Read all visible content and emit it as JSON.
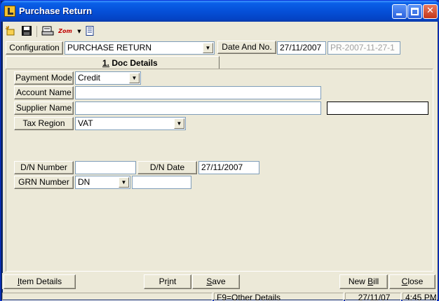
{
  "window": {
    "title": "Purchase Return"
  },
  "toolbar": {
    "icons": [
      "new-icon",
      "save-icon",
      "print-preview-icon",
      "zoom-icon",
      "dropdown-icon",
      "document-icon"
    ],
    "zoom_label": "Zom"
  },
  "header": {
    "configuration_label": "Configuration",
    "doc_type": "PURCHASE RETURN",
    "date_label": "Date And No.",
    "date": "27/11/2007",
    "doc_no": "PR-2007-11-27-1"
  },
  "tab": {
    "number": "1.",
    "label": "Doc Details"
  },
  "form": {
    "payment_mode_label": "Payment Mode",
    "payment_mode": "Credit",
    "account_name_label": "Account Name",
    "account_name": "",
    "supplier_name_label": "Supplier Name",
    "supplier_name": "",
    "tax_region_label": "Tax Region",
    "tax_region": "VAT",
    "dn_number_label": "D/N Number",
    "dn_number": "",
    "dn_date_label": "D/N Date",
    "dn_date": "27/11/2007",
    "grn_number_label": "GRN Number",
    "grn_type": "DN",
    "grn_number": ""
  },
  "buttons": {
    "item_details": {
      "prefix": "",
      "hot": "I",
      "rest": "tem Details"
    },
    "print": {
      "prefix": "Pr",
      "hot": "i",
      "rest": "nt"
    },
    "save": {
      "prefix": "",
      "hot": "S",
      "rest": "ave"
    },
    "new_bill": {
      "prefix": "New ",
      "hot": "B",
      "rest": "ill"
    },
    "close": {
      "prefix": "",
      "hot": "C",
      "rest": "lose"
    }
  },
  "statusbar": {
    "hint": "F9=Other Details",
    "date": "27/11/07",
    "time": "4:45 PM"
  }
}
